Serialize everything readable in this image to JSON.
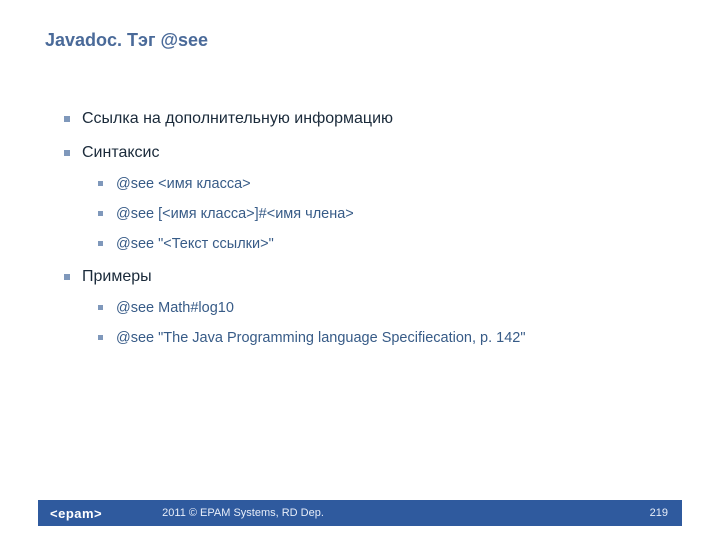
{
  "title": "Javadoc. Тэг @see",
  "bullets": {
    "intro": "Ссылка на дополнительную информацию",
    "syntax_label": "Синтаксис",
    "syntax_items": [
      "@see <имя класса>",
      "@see [<имя класса>]#<имя члена>",
      "@see \"<Текст ссылки>\""
    ],
    "examples_label": "Примеры",
    "examples_items": [
      "@see Math#log10",
      "@see \"The Java Programming language Specifiecation, p. 142\""
    ]
  },
  "footer": {
    "logo": "<epam>",
    "copyright": "2011 © EPAM Systems, RD Dep.",
    "page_number": "219"
  }
}
